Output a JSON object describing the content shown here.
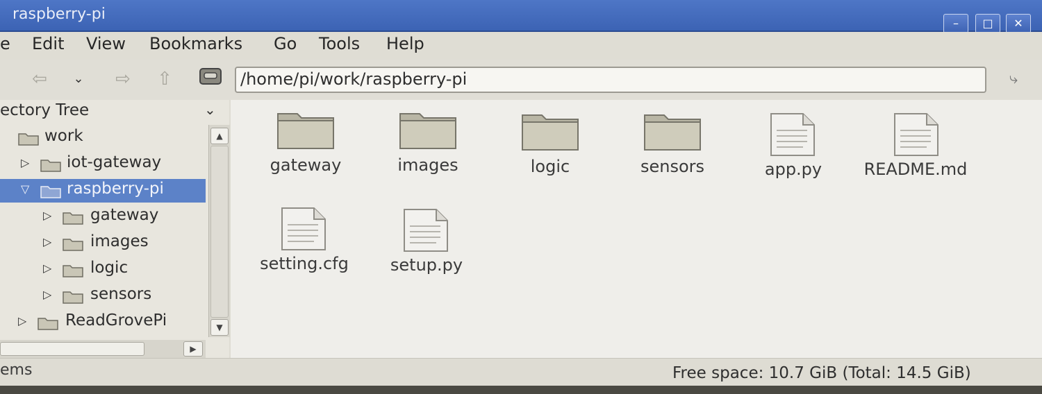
{
  "window": {
    "title": "raspberry-pi",
    "controls": [
      "–",
      "□",
      "✕"
    ]
  },
  "menu": [
    "e",
    "Edit",
    "View",
    "Bookmarks",
    "Go",
    "Tools",
    "Help"
  ],
  "toolbar": {
    "address": "/home/pi/work/raspberry-pi"
  },
  "sidebar": {
    "header": "ectory Tree",
    "tree": [
      {
        "label": "work",
        "arrow": ""
      },
      {
        "label": "iot-gateway",
        "arrow": "▷"
      },
      {
        "label": "raspberry-pi",
        "arrow": "▽",
        "selected": true
      },
      {
        "label": "gateway",
        "arrow": "▷"
      },
      {
        "label": "images",
        "arrow": "▷"
      },
      {
        "label": "logic",
        "arrow": "▷"
      },
      {
        "label": "sensors",
        "arrow": "▷"
      },
      {
        "label": "ReadGrovePi",
        "arrow": "▷"
      }
    ]
  },
  "files": [
    {
      "name": "gateway",
      "type": "folder"
    },
    {
      "name": "images",
      "type": "folder"
    },
    {
      "name": "logic",
      "type": "folder"
    },
    {
      "name": "sensors",
      "type": "folder"
    },
    {
      "name": "app.py",
      "type": "file"
    },
    {
      "name": "README.md",
      "type": "file"
    },
    {
      "name": "setting.cfg",
      "type": "file"
    },
    {
      "name": "setup.py",
      "type": "file"
    }
  ],
  "status": {
    "left": "ems",
    "right": "Free space: 10.7 GiB (Total: 14.5 GiB)"
  }
}
